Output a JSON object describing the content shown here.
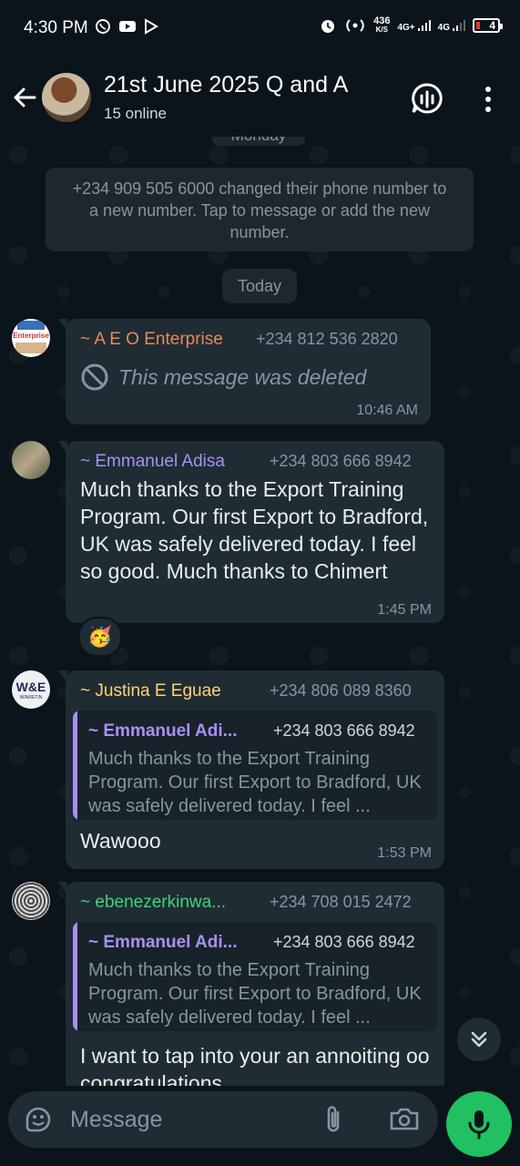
{
  "status_bar": {
    "time": "4:30 PM",
    "speed_value": "436",
    "speed_unit": "K/S",
    "net1": "4G+",
    "net2": "4G",
    "battery": "4"
  },
  "header": {
    "title": "21st June 2025 Q and A",
    "subtitle": "15 online"
  },
  "chat": {
    "prev_day": "Monday",
    "system_message": "+234 909 505 6000 changed their phone number to a new number. Tap to message or add the new number.",
    "day_divider": "Today",
    "messages": [
      {
        "sender": "~ A E O Enterprise",
        "sender_color": "#e78a5c",
        "phone": "+234 812 536 2820",
        "deleted_text": "This message was deleted",
        "time": "10:46 AM",
        "avatar_label": "Enterprise"
      },
      {
        "sender": "~ Emmanuel Adisa",
        "sender_color": "#a791f3",
        "phone": "+234 803 666 8942",
        "text": "Much thanks to the Export Training Program. Our first Export to Bradford, UK was safely delivered today. I feel so good. Much thanks to Chimert",
        "time": "1:45 PM",
        "reaction": "🥳"
      },
      {
        "sender": "~ Justina E Eguae",
        "sender_color": "#ffd279",
        "phone": "+234 806 089 8360",
        "quote": {
          "sender": "~ Emmanuel Adi...",
          "phone": "+234 803 666 8942",
          "text": "Much thanks to the Export Training Program. Our first Export to Bradford, UK was safely delivered today. I feel ..."
        },
        "text": "Wawooo",
        "time": "1:53 PM",
        "avatar_label": "WINRETIN"
      },
      {
        "sender": "~ ebenezerkinwa...",
        "sender_color": "#53bdeb",
        "phone": "+234 708 015 2472",
        "quote": {
          "sender": "~ Emmanuel Adi...",
          "phone": "+234 803 666 8942",
          "text": "Much thanks to the Export Training Program. Our first Export to Bradford, UK was safely delivered today. I feel ..."
        },
        "text": "I want to tap into your an annoiting oo congratulations"
      }
    ]
  },
  "input": {
    "placeholder": "Message"
  },
  "colors": {
    "background": "#0b141a",
    "bubble": "#1f2c34",
    "accent_green": "#21c063"
  }
}
